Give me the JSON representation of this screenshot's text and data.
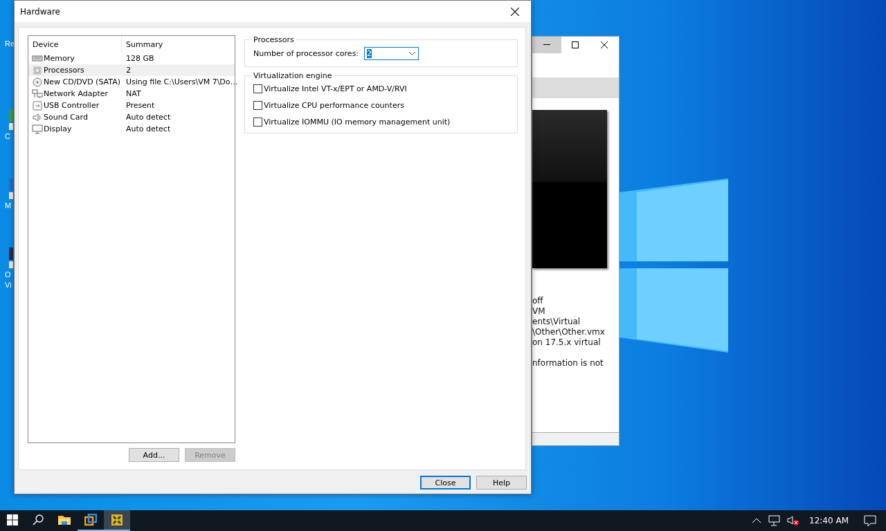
{
  "desktop_icons": [
    {
      "lines": [
        "Re"
      ]
    },
    {
      "lines": [
        "C"
      ]
    },
    {
      "lines": [
        "M"
      ]
    },
    {
      "lines": [
        "O",
        "Vi"
      ]
    }
  ],
  "background_window": {
    "lines": [
      "off",
      "VM",
      "ents\\Virtual",
      "\\Other\\Other.vmx",
      "on 17.5.x virtual",
      "nformation is not"
    ]
  },
  "dialog": {
    "title": "Hardware",
    "table": {
      "columns": [
        "Device",
        "Summary"
      ],
      "rows": [
        {
          "kind": "memory",
          "device": "Memory",
          "summary": "128 GB",
          "selected": false
        },
        {
          "kind": "cpu",
          "device": "Processors",
          "summary": "2",
          "selected": true
        },
        {
          "kind": "disc",
          "device": "New CD/DVD (SATA)",
          "summary": "Using file C:\\Users\\VM 7\\Do…",
          "selected": false
        },
        {
          "kind": "network",
          "device": "Network Adapter",
          "summary": "NAT",
          "selected": false
        },
        {
          "kind": "usb",
          "device": "USB Controller",
          "summary": "Present",
          "selected": false
        },
        {
          "kind": "sound",
          "device": "Sound Card",
          "summary": "Auto detect",
          "selected": false
        },
        {
          "kind": "display",
          "device": "Display",
          "summary": "Auto detect",
          "selected": false
        }
      ]
    },
    "list_buttons": [
      {
        "label": "Add...",
        "disabled": false
      },
      {
        "label": "Remove",
        "disabled": true
      }
    ],
    "processors": {
      "title": "Processors",
      "cores_label": "Number of processor cores:",
      "cores_value": "2"
    },
    "virtualization": {
      "title": "Virtualization engine",
      "options": [
        {
          "label": "Virtualize Intel VT-x/EPT or AMD-V/RVI",
          "checked": false
        },
        {
          "label": "Virtualize CPU performance counters",
          "checked": false
        },
        {
          "label": "Virtualize IOMMU (IO memory management unit)",
          "checked": false
        }
      ]
    },
    "buttons": [
      {
        "label": "Close",
        "default": true
      },
      {
        "label": "Help",
        "default": false
      }
    ]
  },
  "taskbar": {
    "apps": [
      {
        "kind": "folder",
        "selected": false
      },
      {
        "kind": "boxes",
        "selected": false
      },
      {
        "kind": "vmware",
        "selected": true
      }
    ],
    "clock": "12:40 AM"
  }
}
